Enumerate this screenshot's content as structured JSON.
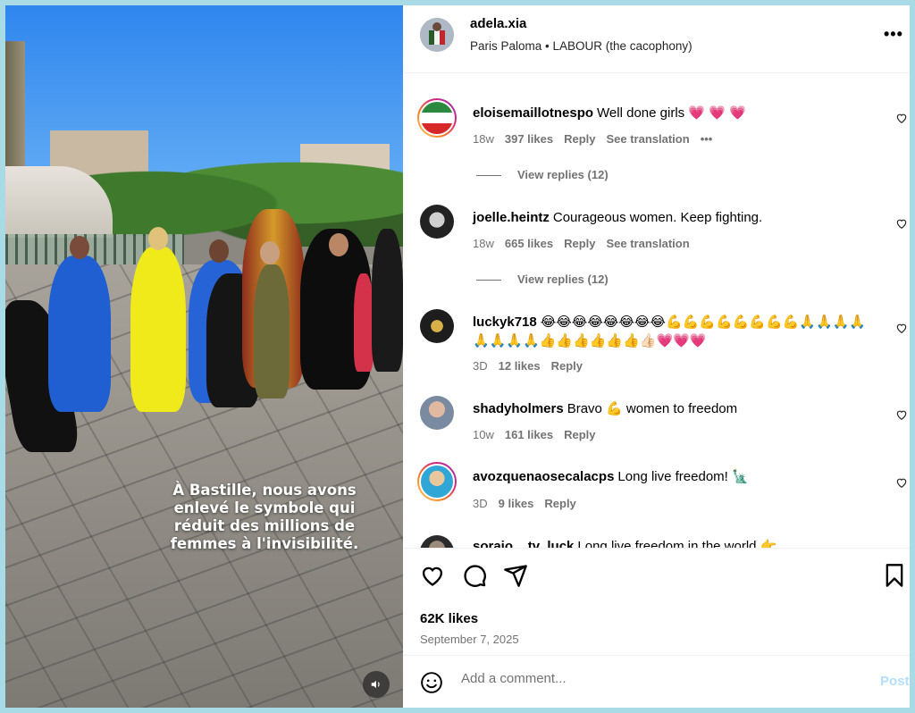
{
  "media": {
    "overlay_text": "À Bastille, nous avons enlevé le symbole qui réduit des millions de femmes à l'invisibilité.",
    "sound_icon": "speaker-icon"
  },
  "header": {
    "username": "adela.xia",
    "audio": "Paris Paloma • LABOUR (the cacophony)",
    "more_icon": "more-horizontal-icon"
  },
  "comments": [
    {
      "user": "eloisemaillotnespo",
      "text": "Well done girls 💗 💗 💗",
      "age": "18w",
      "likes": "397 likes",
      "reply": "Reply",
      "translation": "See translation",
      "options": "•••",
      "view_replies": "View replies (12)"
    },
    {
      "user": "joelle.heintz",
      "text": "Courageous women. Keep fighting.",
      "age": "18w",
      "likes": "665 likes",
      "reply": "Reply",
      "translation": "See translation",
      "view_replies": "View replies (12)"
    },
    {
      "user": "luckyk718",
      "text": "😂😂😂😂😂😂😂😂💪💪💪💪💪💪💪💪🙏🙏🙏🙏🙏🙏🙏🙏👍👍👍👍👍👍👍🏻💗💗💗",
      "age": "3D",
      "likes": "12 likes",
      "reply": "Reply"
    },
    {
      "user": "shadyholmers",
      "text": "Bravo 💪 women to freedom",
      "age": "10w",
      "likes": "161 likes",
      "reply": "Reply"
    },
    {
      "user": "avozquenaosecalacps",
      "text": "Long live freedom! 🗽",
      "age": "3D",
      "likes": "9 likes",
      "reply": "Reply"
    },
    {
      "user": "soraio__tv_luck",
      "text": "Long live freedom in the world 👉"
    }
  ],
  "actions": {
    "likes": "62K likes",
    "date": "September 7, 2025"
  },
  "add_comment": {
    "placeholder": "Add a comment...",
    "post": "Post"
  },
  "colors": {
    "accent": "#0095f6",
    "post_disabled": "#b2dffc",
    "like_red": "#ff3040",
    "muted": "#737373",
    "frame_bg": "#a9dbe6"
  }
}
